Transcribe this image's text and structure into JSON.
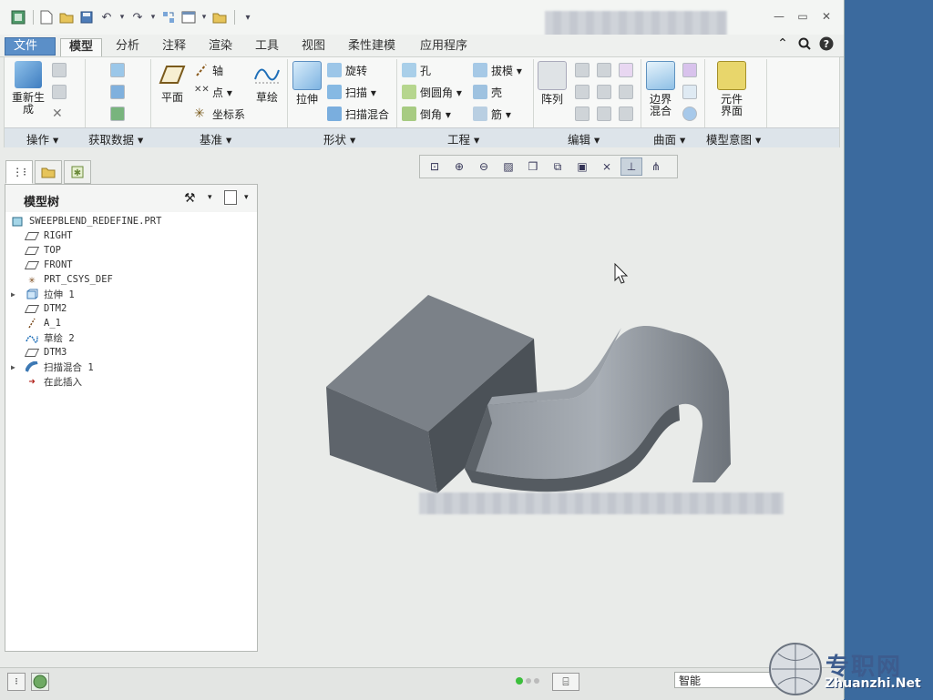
{
  "menu": {
    "file": "文件",
    "file_caret": "▾",
    "tabs": [
      "模型",
      "分析",
      "注释",
      "渲染",
      "工具",
      "视图",
      "柔性建模",
      "应用程序"
    ]
  },
  "ribbon": {
    "ops": {
      "regen": "重新生成",
      "group": "操作 ▾"
    },
    "getdata": {
      "group": "获取数据 ▾"
    },
    "datum": {
      "plane": "平面",
      "axis": "轴",
      "point": "点 ▾",
      "csys": "坐标系",
      "sketch": "草绘",
      "group": "基准 ▾"
    },
    "shape": {
      "extrude": "拉伸",
      "revolve": "旋转",
      "sweep": "扫描 ▾",
      "sweepblend": "扫描混合",
      "group": "形状 ▾"
    },
    "eng": {
      "hole": "孔",
      "round": "倒圆角 ▾",
      "chamfer": "倒角 ▾",
      "draft": "拔模 ▾",
      "shell": "壳",
      "rib": "筋 ▾",
      "group": "工程 ▾"
    },
    "edit": {
      "pattern": "阵列",
      "group": "编辑 ▾"
    },
    "surface": {
      "boundary": "边界混合",
      "group": "曲面 ▾"
    },
    "intent": {
      "component": "元件界面",
      "group": "模型意图 ▾"
    }
  },
  "tree": {
    "title": "模型树",
    "items": [
      {
        "label": "SWEEPBLEND_REDEFINE.PRT",
        "icon": "part-icon"
      },
      {
        "label": "RIGHT",
        "icon": "datum-plane-icon"
      },
      {
        "label": "TOP",
        "icon": "datum-plane-icon"
      },
      {
        "label": "FRONT",
        "icon": "datum-plane-icon"
      },
      {
        "label": "PRT_CSYS_DEF",
        "icon": "csys-icon"
      },
      {
        "label": "拉伸 1",
        "icon": "extrude-icon",
        "expandable": true
      },
      {
        "label": "DTM2",
        "icon": "datum-plane-icon"
      },
      {
        "label": "A_1",
        "icon": "axis-icon"
      },
      {
        "label": "草绘 2",
        "icon": "sketch-icon"
      },
      {
        "label": "DTM3",
        "icon": "datum-plane-icon"
      },
      {
        "label": "扫描混合 1",
        "icon": "sweep-blend-icon",
        "expandable": true
      },
      {
        "label": "在此插入",
        "icon": "insert-here-icon"
      }
    ]
  },
  "status": {
    "filter": "智能"
  },
  "watermark": {
    "cn": "专职网",
    "en": "Zhuanzhi.Net"
  },
  "colors": {
    "file_tab": "#5b8fc8",
    "model_gray": "#6f767d",
    "desktop": "#3b6a9e"
  }
}
